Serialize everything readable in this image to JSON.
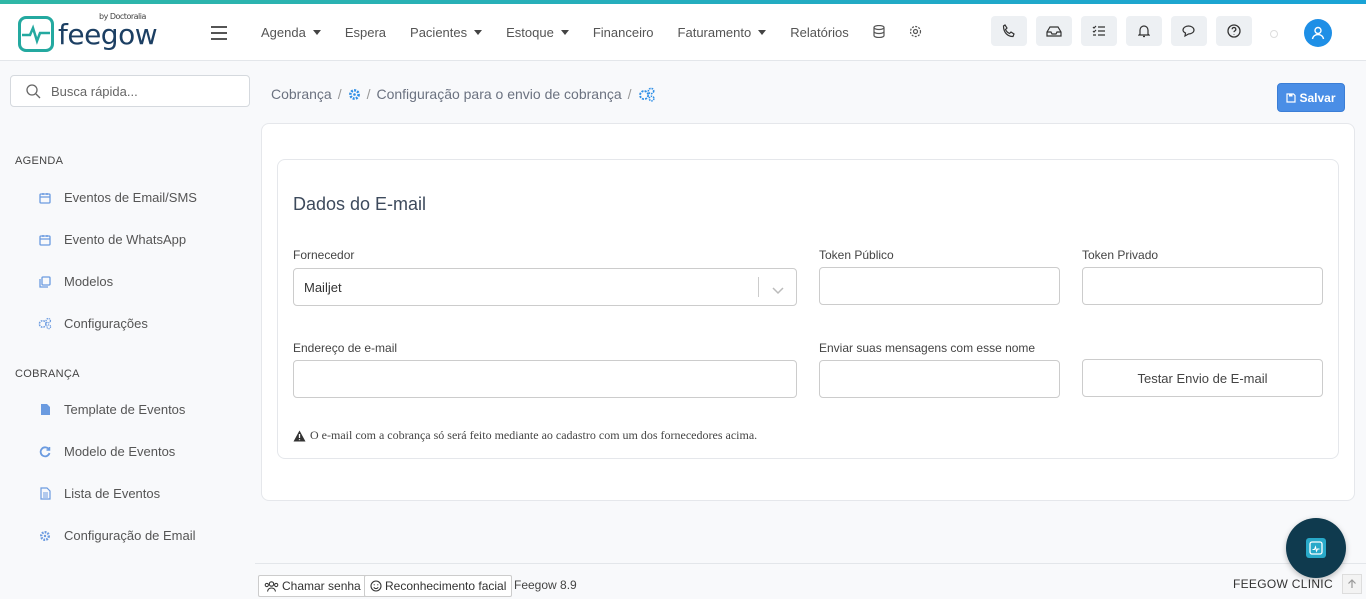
{
  "brand": {
    "name": "feegow",
    "by": "by Doctoralia"
  },
  "nav": {
    "items": [
      {
        "label": "Agenda",
        "dropdown": true
      },
      {
        "label": "Espera",
        "dropdown": false
      },
      {
        "label": "Pacientes",
        "dropdown": true
      },
      {
        "label": "Estoque",
        "dropdown": true
      },
      {
        "label": "Financeiro",
        "dropdown": false
      },
      {
        "label": "Faturamento",
        "dropdown": true
      },
      {
        "label": "Relatórios",
        "dropdown": false
      }
    ],
    "icons": [
      "database-icon",
      "gear-icon"
    ],
    "toolbar_icons": [
      "phone-icon",
      "inbox-icon",
      "checklist-icon",
      "bell-icon",
      "chat-icon",
      "help-icon"
    ]
  },
  "search": {
    "placeholder": "Busca rápida..."
  },
  "sidebar": {
    "sections": [
      {
        "title": "AGENDA",
        "items": [
          {
            "label": "Eventos de Email/SMS",
            "icon": "calendar-icon"
          },
          {
            "label": "Evento de WhatsApp",
            "icon": "calendar-icon"
          },
          {
            "label": "Modelos",
            "icon": "copy-icon"
          },
          {
            "label": "Configurações",
            "icon": "gears-icon"
          }
        ]
      },
      {
        "title": "COBRANÇA",
        "items": [
          {
            "label": "Template de Eventos",
            "icon": "file-icon"
          },
          {
            "label": "Modelo de Eventos",
            "icon": "refresh-icon"
          },
          {
            "label": "Lista de Eventos",
            "icon": "list-file-icon"
          },
          {
            "label": "Configuração de Email",
            "icon": "gear-icon"
          }
        ]
      }
    ]
  },
  "breadcrumb": {
    "items": [
      "Cobrança",
      "Configuração para o envio de cobrança"
    ]
  },
  "save_label": "Salvar",
  "card": {
    "title": "Dados do E-mail",
    "fornecedor_label": "Fornecedor",
    "fornecedor_value": "Mailjet",
    "token_publico_label": "Token Público",
    "token_publico_value": "",
    "token_privado_label": "Token Privado",
    "token_privado_value": "",
    "email_label": "Endereço de e-mail",
    "email_value": "",
    "sender_name_label": "Enviar suas mensagens com esse nome",
    "sender_name_value": "",
    "test_button": "Testar Envio de E-mail",
    "warning": "O e-mail com a cobrança só será feito mediante ao cadastro com um dos fornecedores acima."
  },
  "footer": {
    "call_password": "Chamar senha",
    "face_recognition": "Reconhecimento facial",
    "version": "Feegow 8.9",
    "brand": "FEEGOW CLINIC"
  },
  "colors": {
    "accent": "#4a8ee6",
    "brand_teal": "#24a9a0",
    "brand_navy": "#1c3f63"
  }
}
